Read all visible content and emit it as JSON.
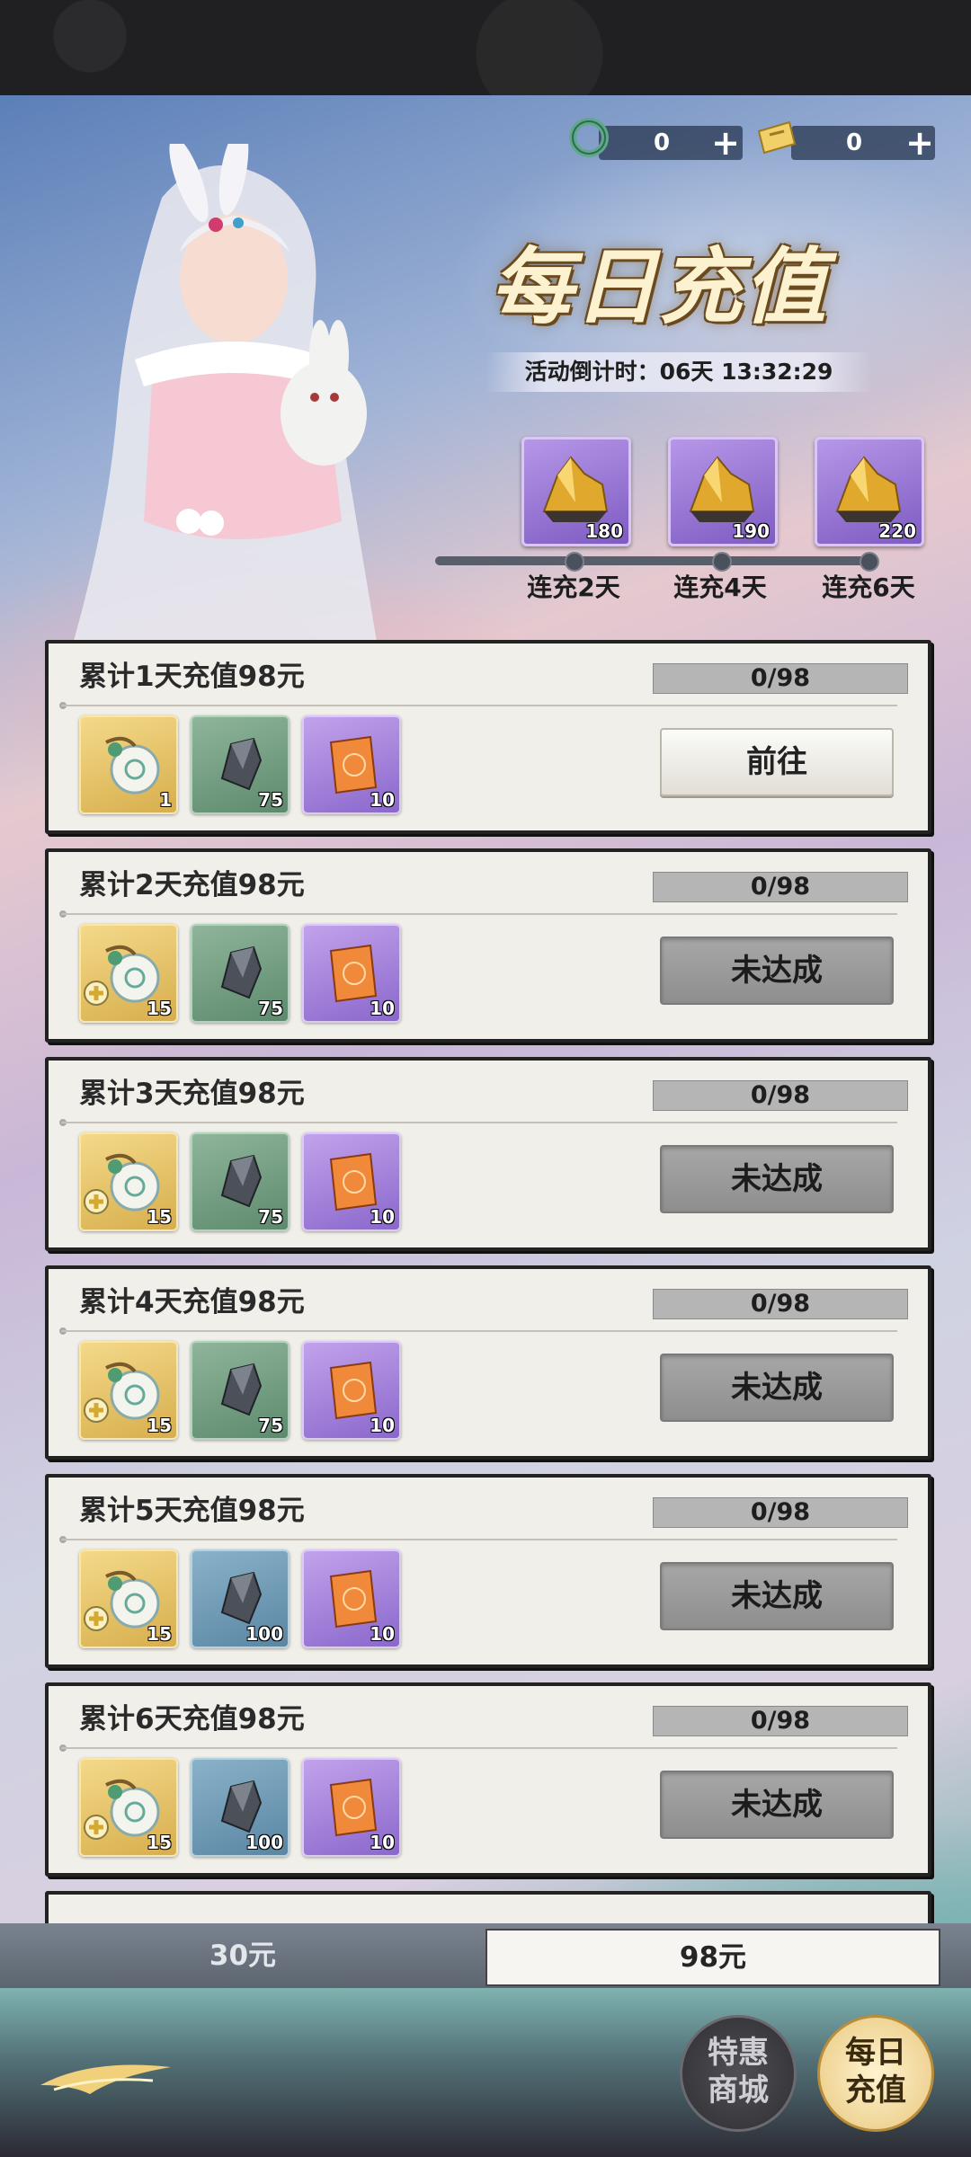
{
  "currency": [
    {
      "icon": "jade-coin-icon",
      "value": "0",
      "plus": "+"
    },
    {
      "icon": "gold-ticket-icon",
      "value": "0",
      "plus": "+"
    }
  ],
  "header": {
    "title": "每日充值",
    "countdown_label": "活动倒计时：",
    "countdown_value": "06天 13:32:29"
  },
  "milestones": [
    {
      "count": "180",
      "label": "连充2天",
      "icon": "gold-crystal-icon"
    },
    {
      "count": "190",
      "label": "连充4天",
      "icon": "gold-crystal-icon"
    },
    {
      "count": "220",
      "label": "连充6天",
      "icon": "gold-crystal-icon"
    }
  ],
  "tasks": [
    {
      "title": "累计1天充值98元",
      "progress": "0/98",
      "progress_fraction": 0,
      "button": "前往",
      "state": "go",
      "rewards": [
        {
          "type": "gold",
          "icon": "jade-pendant-icon",
          "count": "1"
        },
        {
          "type": "green",
          "icon": "ore-icon",
          "count": "75"
        },
        {
          "type": "purple",
          "icon": "scroll-card-icon",
          "count": "10"
        }
      ]
    },
    {
      "title": "累计2天充值98元",
      "progress": "0/98",
      "progress_fraction": 0,
      "button": "未达成",
      "state": "na",
      "rewards": [
        {
          "type": "gold",
          "icon": "jade-pendant-icon",
          "count": "15"
        },
        {
          "type": "green",
          "icon": "ore-icon",
          "count": "75"
        },
        {
          "type": "purple",
          "icon": "scroll-card-icon",
          "count": "10"
        }
      ]
    },
    {
      "title": "累计3天充值98元",
      "progress": "0/98",
      "progress_fraction": 0,
      "button": "未达成",
      "state": "na",
      "rewards": [
        {
          "type": "gold",
          "icon": "jade-pendant-icon",
          "count": "15"
        },
        {
          "type": "green",
          "icon": "ore-icon",
          "count": "75"
        },
        {
          "type": "purple",
          "icon": "scroll-card-icon",
          "count": "10"
        }
      ]
    },
    {
      "title": "累计4天充值98元",
      "progress": "0/98",
      "progress_fraction": 0,
      "button": "未达成",
      "state": "na",
      "rewards": [
        {
          "type": "gold",
          "icon": "jade-pendant-icon",
          "count": "15"
        },
        {
          "type": "green",
          "icon": "ore-icon",
          "count": "75"
        },
        {
          "type": "purple",
          "icon": "scroll-card-icon",
          "count": "10"
        }
      ]
    },
    {
      "title": "累计5天充值98元",
      "progress": "0/98",
      "progress_fraction": 0,
      "button": "未达成",
      "state": "na",
      "rewards": [
        {
          "type": "gold",
          "icon": "jade-pendant-icon",
          "count": "15"
        },
        {
          "type": "blue",
          "icon": "ore-icon",
          "count": "100"
        },
        {
          "type": "purple",
          "icon": "scroll-card-icon",
          "count": "10"
        }
      ]
    },
    {
      "title": "累计6天充值98元",
      "progress": "0/98",
      "progress_fraction": 0,
      "button": "未达成",
      "state": "na",
      "rewards": [
        {
          "type": "gold",
          "icon": "jade-pendant-icon",
          "count": "15"
        },
        {
          "type": "blue",
          "icon": "ore-icon",
          "count": "100"
        },
        {
          "type": "purple",
          "icon": "scroll-card-icon",
          "count": "10"
        }
      ]
    }
  ],
  "tiers": {
    "left": "30元",
    "right": "98元",
    "selected": "98元"
  },
  "nav": {
    "shop": [
      "特惠",
      "商城"
    ],
    "daily": [
      "每日",
      "充值"
    ]
  },
  "colors": {
    "progress_fill": "#e2a63c",
    "gold_item": "#e7c36a",
    "purple_item": "#a684dd",
    "green_item": "#77a083",
    "blue_item": "#719cb6"
  }
}
